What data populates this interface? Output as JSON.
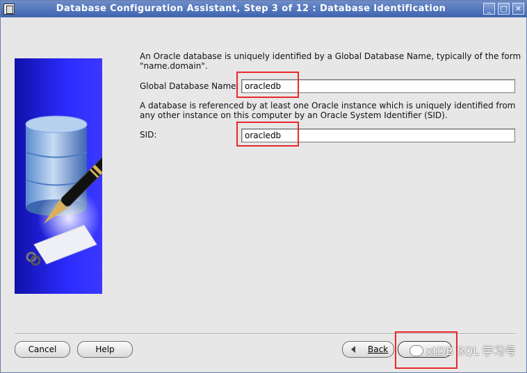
{
  "window": {
    "title": "Database Configuration Assistant, Step 3 of 12 : Database Identification",
    "controls": {
      "minimize": "_",
      "maximize": "□",
      "close": "✕"
    }
  },
  "description": {
    "line1": "An Oracle database is uniquely identified by a Global Database Name, typically of the form",
    "line2": "\"name.domain\"."
  },
  "global_db_name": {
    "label": "Global Database Name:",
    "value": "oracledb"
  },
  "sid_description": {
    "line1": "A database is referenced by at least one Oracle instance which is uniquely identified from",
    "line2": "any other instance on this computer by an Oracle System Identifier (SID)."
  },
  "sid": {
    "label": "SID:",
    "value": "oracledb"
  },
  "buttons": {
    "cancel": "Cancel",
    "help": "Help",
    "back": "Back"
  },
  "watermark": {
    "text": "xtDB SQL 学习号"
  },
  "colors": {
    "title_bar": "#4a6fb8",
    "annotation": "#e8282c",
    "side_image": "#2a2aff"
  }
}
